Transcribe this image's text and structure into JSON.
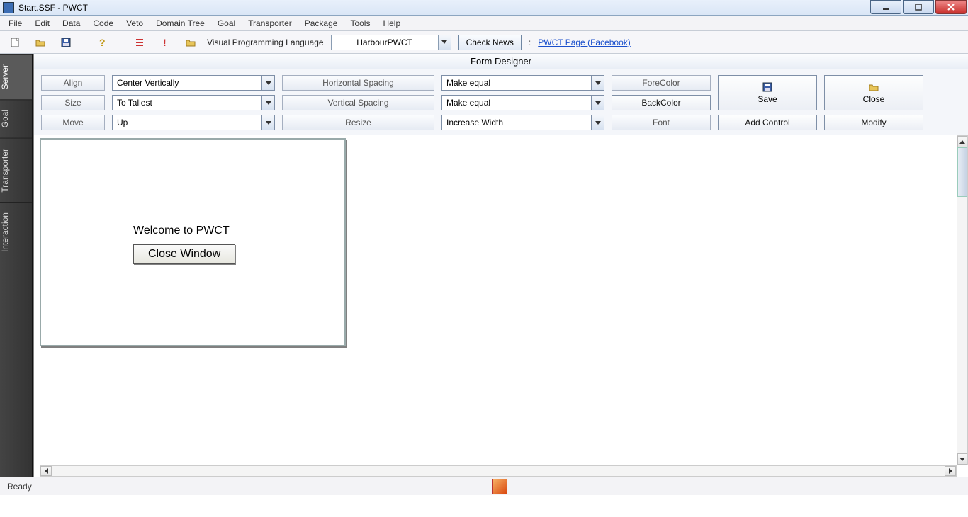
{
  "window": {
    "title": "Start.SSF  - PWCT"
  },
  "menu": [
    "File",
    "Edit",
    "Data",
    "Code",
    "Veto",
    "Domain Tree",
    "Goal",
    "Transporter",
    "Package",
    "Tools",
    "Help"
  ],
  "toolbar": {
    "vpl_label": "Visual Programming Language",
    "language_combo": "HarbourPWCT",
    "check_news": "Check News",
    "sep": ":",
    "fb_link": "PWCT Page (Facebook)"
  },
  "side_tabs": [
    "Server",
    "Goal",
    "Transporter",
    "Interaction"
  ],
  "pane_title": "Form Designer",
  "controls": {
    "row1": {
      "btn": "Align",
      "combo": "Center Vertically",
      "btn2": "Horizontal Spacing",
      "combo2": "Make equal",
      "btn3": "ForeColor"
    },
    "row2": {
      "btn": "Size",
      "combo": "To Tallest",
      "btn2": "Vertical Spacing",
      "combo2": "Make equal",
      "btn3": "BackColor"
    },
    "row3": {
      "btn": "Move",
      "combo": "Up",
      "btn2": "Resize",
      "combo2": "Increase Width",
      "btn3": "Font",
      "btn4": "Add Control",
      "btn5": "Modify"
    },
    "save": "Save",
    "close": "Close"
  },
  "form": {
    "welcome": "Welcome to PWCT",
    "close_window": "Close Window"
  },
  "status": {
    "ready": "Ready"
  }
}
